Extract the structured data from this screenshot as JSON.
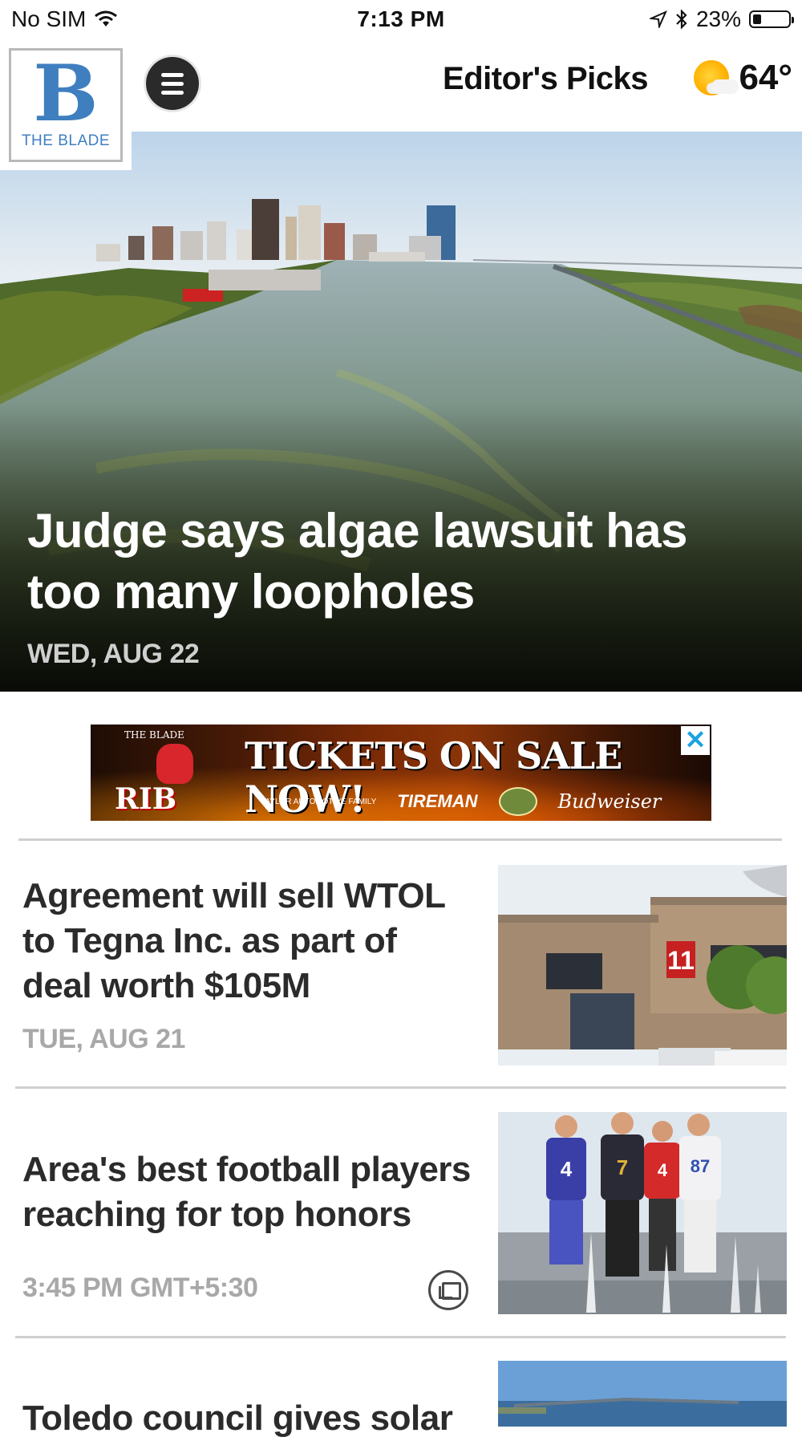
{
  "status_bar": {
    "carrier": "No SIM",
    "time": "7:13 PM",
    "battery": "23%",
    "battery_level": 0.23,
    "icons": [
      "wifi-icon",
      "location-arrow-icon",
      "bluetooth-icon",
      "battery-icon"
    ]
  },
  "header": {
    "logo_letter": "B",
    "logo_text": "THE BLADE",
    "menu_icon": "hamburger-menu-icon",
    "section_title": "Editor's Picks",
    "weather_icon": "partly-sunny-icon",
    "temperature": "64°"
  },
  "hero": {
    "headline": "Judge says algae lawsuit has too many loopholes",
    "date": "WED, AUG 22"
  },
  "ad": {
    "headline": "TICKETS ON SALE NOW!",
    "event_small": "THE BLADE",
    "event_name": "RIB OFF",
    "sponsor_1": "TAYLOR AUTOMOTIVE FAMILY",
    "sponsor_2": "TIREMAN",
    "sponsor_3": "Budweiser",
    "close_label": "✕"
  },
  "articles": [
    {
      "title": "Agreement will sell WTOL to Tegna Inc. as part of deal worth $105M",
      "date": "TUE, AUG 21",
      "thumb_sign": "11"
    },
    {
      "title": "Area's best football players reaching for top honors",
      "date": "3:45 PM GMT+5:30",
      "gallery_icon": "photo-gallery-icon",
      "jerseys": [
        "4",
        "7",
        "4",
        "87"
      ]
    },
    {
      "title": "Toledo council gives solar"
    }
  ],
  "colors": {
    "brand_blue": "#3f7fc0",
    "divider": "#cfcfcf",
    "date_gray": "#a8a8a8",
    "ad_close": "#1aa3e0"
  }
}
